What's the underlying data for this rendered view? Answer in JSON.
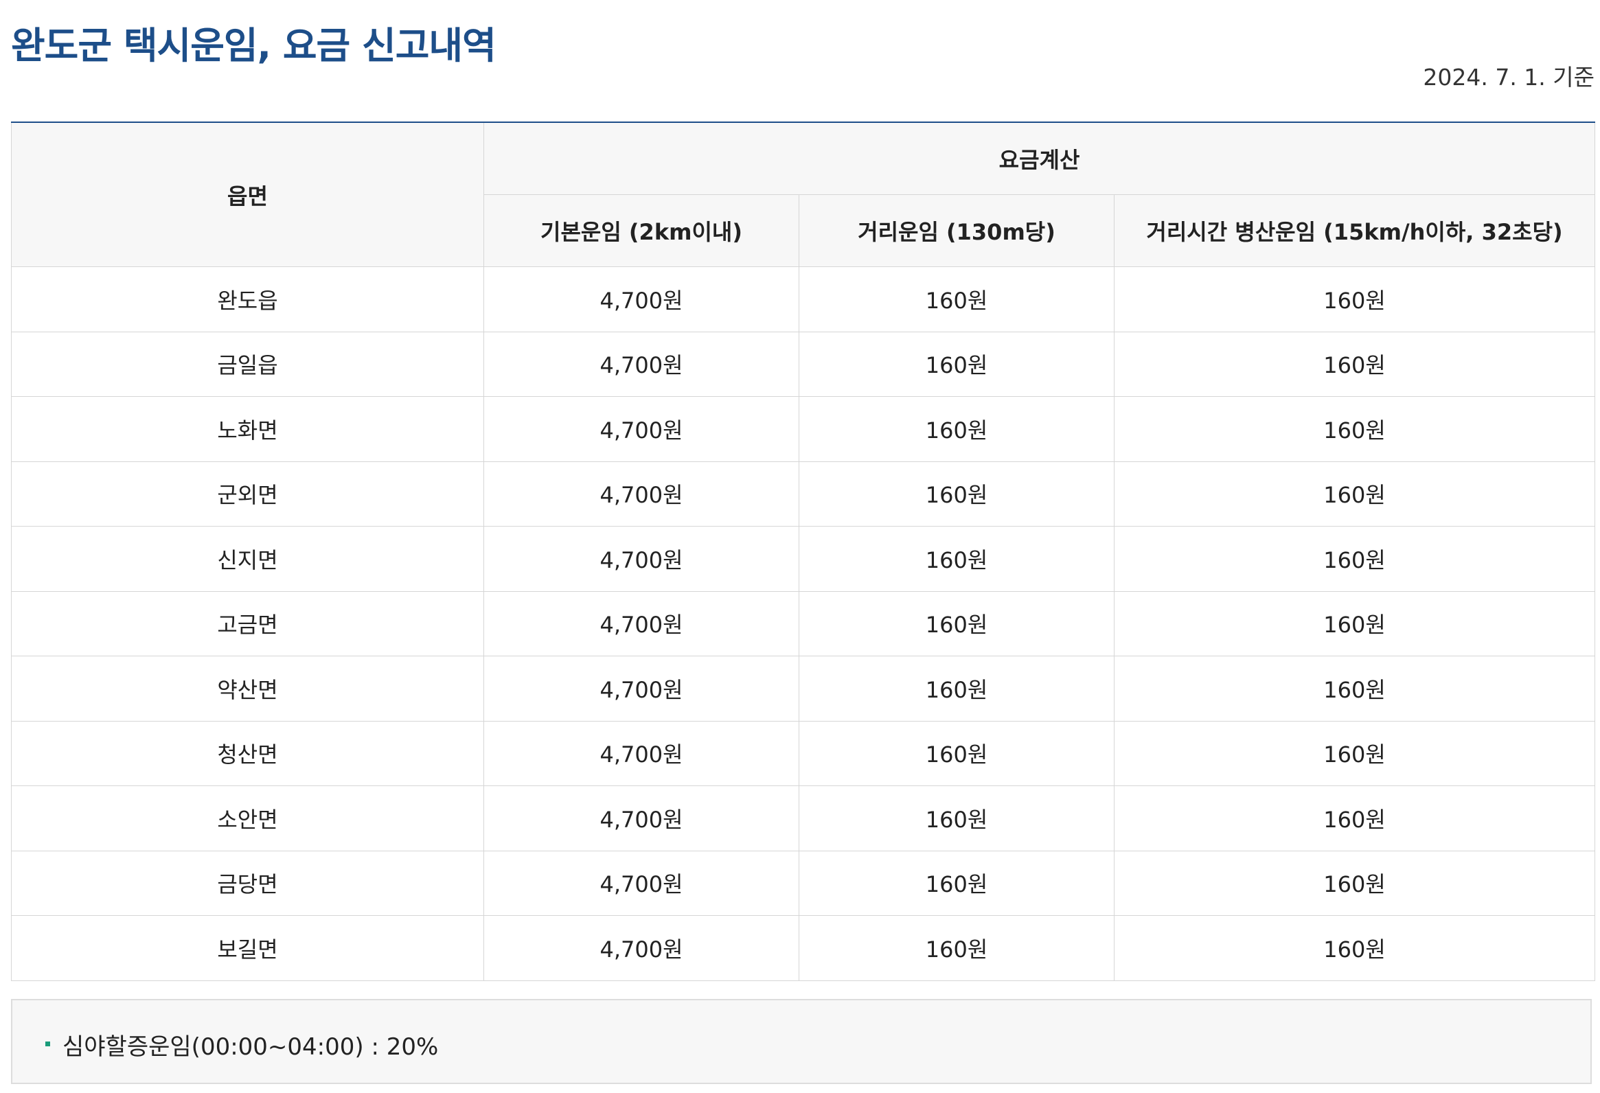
{
  "title": "완도군 택시운임, 요금 신고내역",
  "date_note": "2024. 7. 1. 기준",
  "table": {
    "headers": {
      "region": "읍면",
      "fare_group": "요금계산",
      "base_fare": "기본운임 (2km이내)",
      "distance_fare": "거리운임 (130m당)",
      "combined_fare": "거리시간 병산운임 (15km/h이하, 32초당)"
    },
    "rows": [
      {
        "region": "완도읍",
        "base_fare": "4,700원",
        "distance_fare": "160원",
        "combined_fare": "160원"
      },
      {
        "region": "금일읍",
        "base_fare": "4,700원",
        "distance_fare": "160원",
        "combined_fare": "160원"
      },
      {
        "region": "노화면",
        "base_fare": "4,700원",
        "distance_fare": "160원",
        "combined_fare": "160원"
      },
      {
        "region": "군외면",
        "base_fare": "4,700원",
        "distance_fare": "160원",
        "combined_fare": "160원"
      },
      {
        "region": "신지면",
        "base_fare": "4,700원",
        "distance_fare": "160원",
        "combined_fare": "160원"
      },
      {
        "region": "고금면",
        "base_fare": "4,700원",
        "distance_fare": "160원",
        "combined_fare": "160원"
      },
      {
        "region": "약산면",
        "base_fare": "4,700원",
        "distance_fare": "160원",
        "combined_fare": "160원"
      },
      {
        "region": "청산면",
        "base_fare": "4,700원",
        "distance_fare": "160원",
        "combined_fare": "160원"
      },
      {
        "region": "소안면",
        "base_fare": "4,700원",
        "distance_fare": "160원",
        "combined_fare": "160원"
      },
      {
        "region": "금당면",
        "base_fare": "4,700원",
        "distance_fare": "160원",
        "combined_fare": "160원"
      },
      {
        "region": "보길면",
        "base_fare": "4,700원",
        "distance_fare": "160원",
        "combined_fare": "160원"
      }
    ]
  },
  "notice": {
    "items": [
      "심야할증운임(00:00~04:00) : 20%"
    ]
  },
  "colors": {
    "title": "#1d4e89",
    "header_bg": "#f7f7f7",
    "border": "#d6d6d6",
    "bullet": "#1a9c7a"
  }
}
